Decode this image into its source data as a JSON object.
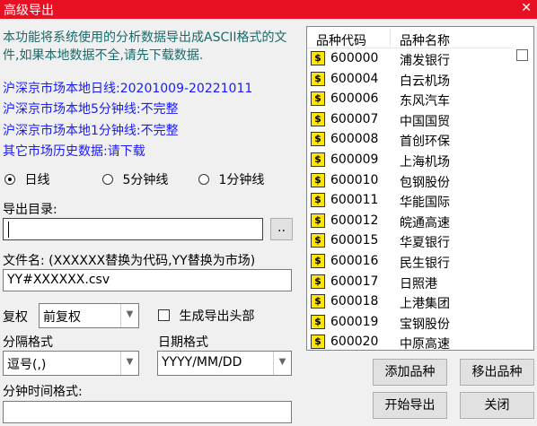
{
  "window": {
    "title": "高级导出",
    "close_glyph": "✕"
  },
  "intro_text": "本功能将系统使用的分析数据导出成ASCII格式的文件,如果本地数据不全,请先下载数据.",
  "status": [
    "沪深京市场本地日线:20201009-20221011",
    "沪深京市场本地5分钟线:不完整",
    "沪深京市场本地1分钟线:不完整",
    "其它市场历史数据:请下载"
  ],
  "period": {
    "options": [
      "日线",
      "5分钟线",
      "1分钟线"
    ],
    "selected_index": 0
  },
  "export_dir": {
    "label": "导出目录:",
    "value": "",
    "browse_label": ".."
  },
  "filename": {
    "label": "文件名:  (XXXXXX替换为代码,YY替换为市场)",
    "value": "YY#XXXXXX.csv"
  },
  "adjust": {
    "label": "复权",
    "value": "前复权"
  },
  "header_checkbox": {
    "label": "生成导出头部",
    "checked": false
  },
  "separator": {
    "label": "分隔格式",
    "value": "逗号(,)"
  },
  "date_format": {
    "label": "日期格式",
    "value": "YYYY/MM/DD"
  },
  "minute_format": {
    "label": "分钟时间格式:",
    "value": ""
  },
  "list": {
    "columns": [
      "品种代码",
      "品种名称"
    ],
    "icon": "dollar-stock-icon",
    "rows": [
      {
        "code": "600000",
        "name": "浦发银行"
      },
      {
        "code": "600004",
        "name": "白云机场"
      },
      {
        "code": "600006",
        "name": "东风汽车"
      },
      {
        "code": "600007",
        "name": "中国国贸"
      },
      {
        "code": "600008",
        "name": "首创环保"
      },
      {
        "code": "600009",
        "name": "上海机场"
      },
      {
        "code": "600010",
        "name": "包钢股份"
      },
      {
        "code": "600011",
        "name": "华能国际"
      },
      {
        "code": "600012",
        "name": "皖通高速"
      },
      {
        "code": "600015",
        "name": "华夏银行"
      },
      {
        "code": "600016",
        "name": "民生银行"
      },
      {
        "code": "600017",
        "name": "日照港"
      },
      {
        "code": "600018",
        "name": "上港集团"
      },
      {
        "code": "600019",
        "name": "宝钢股份"
      },
      {
        "code": "600020",
        "name": "中原高速"
      }
    ]
  },
  "buttons": {
    "add": "添加品种",
    "remove": "移出品种",
    "start": "开始导出",
    "close": "关闭"
  },
  "colors": {
    "titlebar": "#e81123",
    "intro": "#1a6a6a",
    "status": "#1a1aff"
  }
}
